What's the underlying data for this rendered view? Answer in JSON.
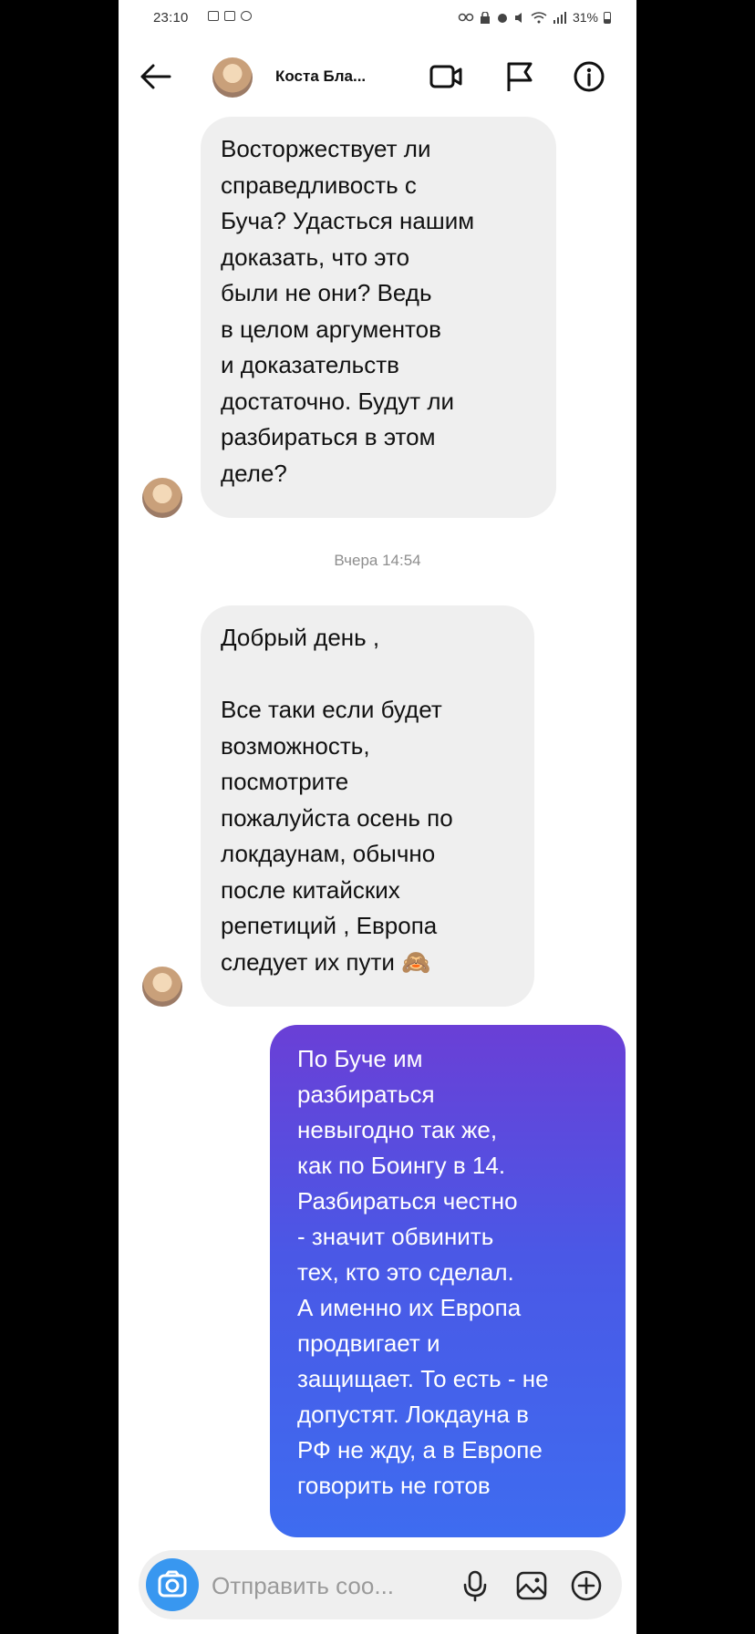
{
  "status_bar": {
    "time": "23:10",
    "battery": "31%"
  },
  "header": {
    "contact_name": "Коста Бла..."
  },
  "messages": [
    {
      "direction": "incoming",
      "text": "Восторжествует ли\nсправедливость с\nБуча? Удасться нашим\nдоказать, что это\nбыли не они? Ведь\nв целом аргументов\nи доказательств\nдостаточно. Будут ли\nразбираться в этом\nделе?"
    },
    {
      "timestamp": "Вчера 14:54"
    },
    {
      "direction": "incoming",
      "text": "Добрый день ,\n\nВсе таки если будет\nвозможность,\nпосмотрите\nпожалуйста осень по\nлокдаунам, обычно\nпосле китайских\nрепетиций , Европа\nследует их пути 🙈"
    },
    {
      "direction": "outgoing",
      "text": "По Буче им\nразбираться\nневыгодно так же,\nкак по Боингу в 14.\nРазбираться честно\n- значит обвинить\nтех, кто это сделал.\nА именно их Европа\nпродвигает и\nзащищает. То есть - не\nдопустят. Локдауна в\nРФ не жду,  а в Европе\nговорить не готов"
    }
  ],
  "composer": {
    "placeholder": "Отправить соо..."
  },
  "icons": {
    "back": "arrow-left-icon",
    "video": "video-camera-icon",
    "flag": "flag-icon",
    "info": "info-icon",
    "camera": "camera-icon",
    "mic": "microphone-icon",
    "gallery": "image-icon",
    "add": "plus-circle-icon"
  },
  "colors": {
    "incoming_bubble": "#efefef",
    "outgoing_gradient_top": "#6a3fd6",
    "outgoing_gradient_bottom": "#3e6cf0",
    "camera_button": "#3897f0"
  }
}
